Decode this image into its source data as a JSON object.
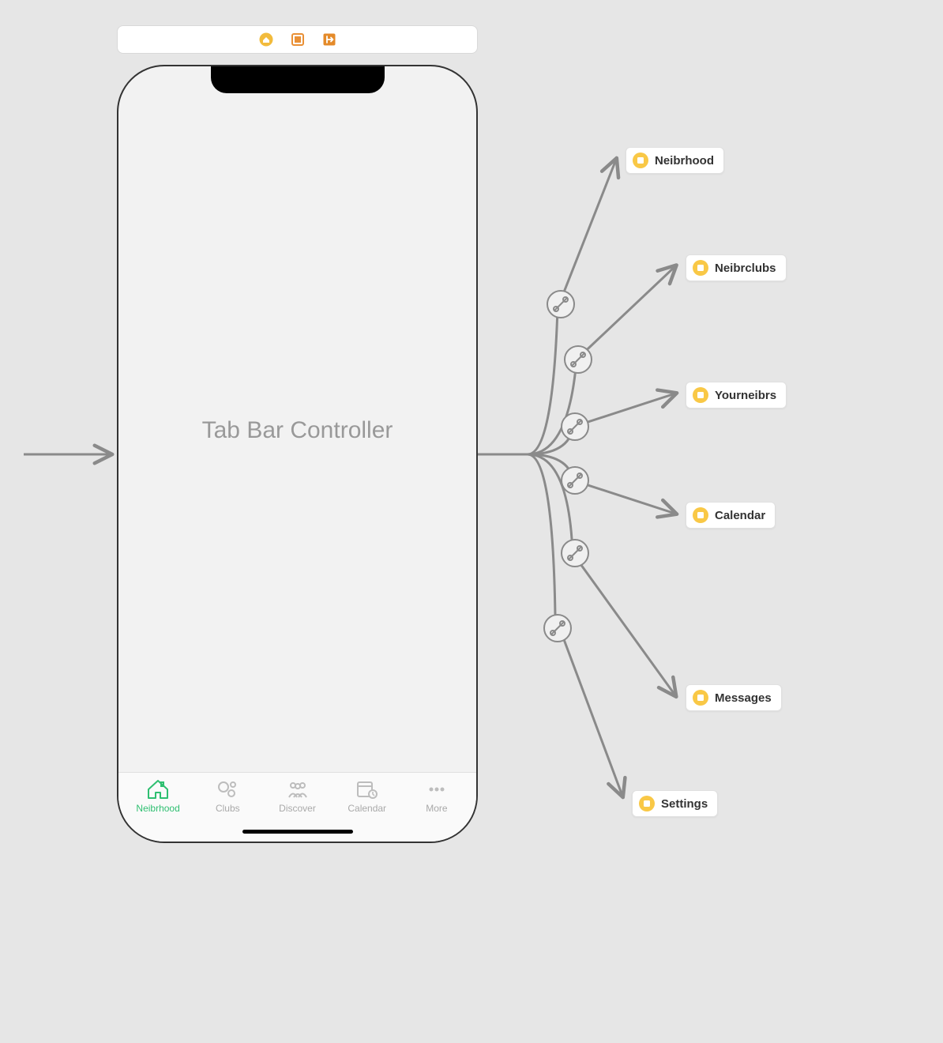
{
  "screen_title": "Tab Bar Controller",
  "colors": {
    "active_tab": "#2fbf71",
    "inactive_tab": "#a9a9a9",
    "dest_icon_bg": "#f9c846",
    "toolbar_icon_orange": "#e99036",
    "toolbar_icon_dark_orange": "#e48a29",
    "toolbar_icon_yellow": "#f2bb3c"
  },
  "toolbar_icons": [
    "scene-dock-home-icon",
    "scene-dock-firstresponder-icon",
    "scene-dock-exit-icon"
  ],
  "tabs": [
    {
      "label": "Neibrhood",
      "icon": "house-icon",
      "active": true
    },
    {
      "label": "Clubs",
      "icon": "people-tree-icon",
      "active": false
    },
    {
      "label": "Discover",
      "icon": "people-group-icon",
      "active": false
    },
    {
      "label": "Calendar",
      "icon": "calendar-clock-icon",
      "active": false
    },
    {
      "label": "More",
      "icon": "more-dots-icon",
      "active": false
    }
  ],
  "destinations": [
    {
      "label": "Neibrhood"
    },
    {
      "label": "Neibrclubs"
    },
    {
      "label": "Yourneibrs"
    },
    {
      "label": "Calendar"
    },
    {
      "label": "Messages"
    },
    {
      "label": "Settings"
    }
  ]
}
